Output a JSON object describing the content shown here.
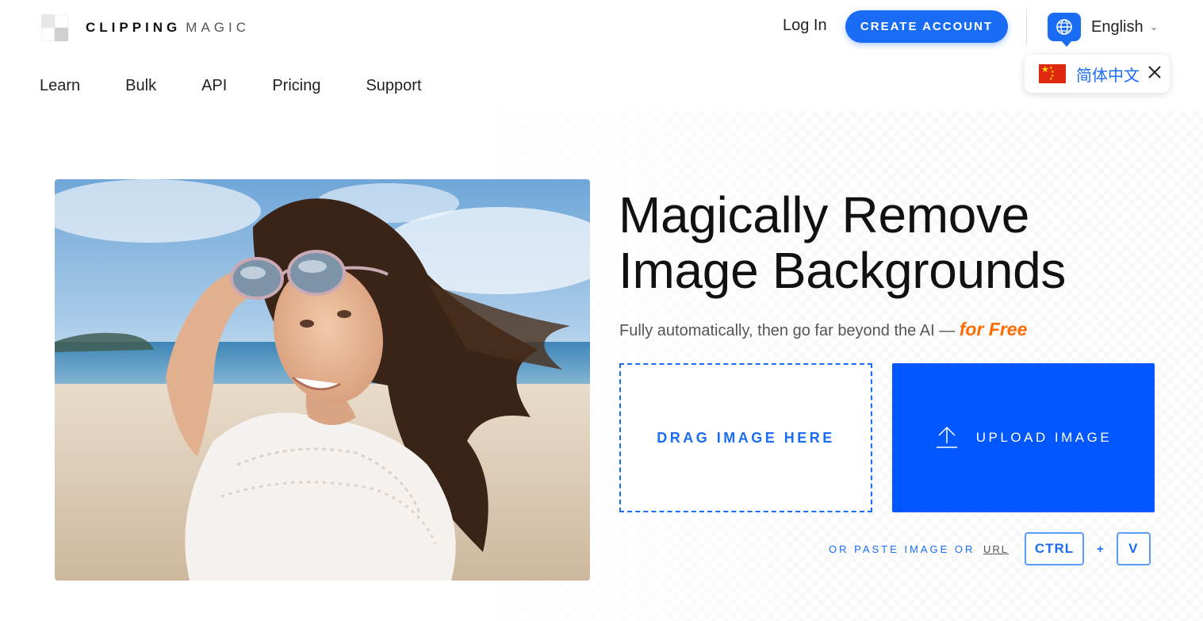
{
  "brand": {
    "word1": "CLIPPING",
    "word2": "MAGIC"
  },
  "nav": {
    "items": [
      "Learn",
      "Bulk",
      "API",
      "Pricing",
      "Support"
    ]
  },
  "header": {
    "login_label": "Log In",
    "create_account_label": "CREATE ACCOUNT",
    "language_label": "English"
  },
  "lang_popup": {
    "label": "简体中文"
  },
  "hero": {
    "headline_line1": "Magically Remove",
    "headline_line2": "Image Backgrounds",
    "subline_main": "Fully automatically, then go far beyond the AI — ",
    "subline_free": "for Free",
    "drag_label": "DRAG IMAGE HERE",
    "upload_label": "UPLOAD IMAGE",
    "paste_text": "OR PASTE IMAGE OR",
    "paste_url": "URL",
    "key_ctrl": "CTRL",
    "key_plus": "+",
    "key_v": "V"
  },
  "colors": {
    "accent": "#1a6cf5",
    "upload": "#0057ff",
    "free": "#ff6a00"
  },
  "icons": [
    "logo-mark",
    "globe-icon",
    "chevron-down-icon",
    "china-flag-icon",
    "close-icon",
    "upload-icon"
  ]
}
